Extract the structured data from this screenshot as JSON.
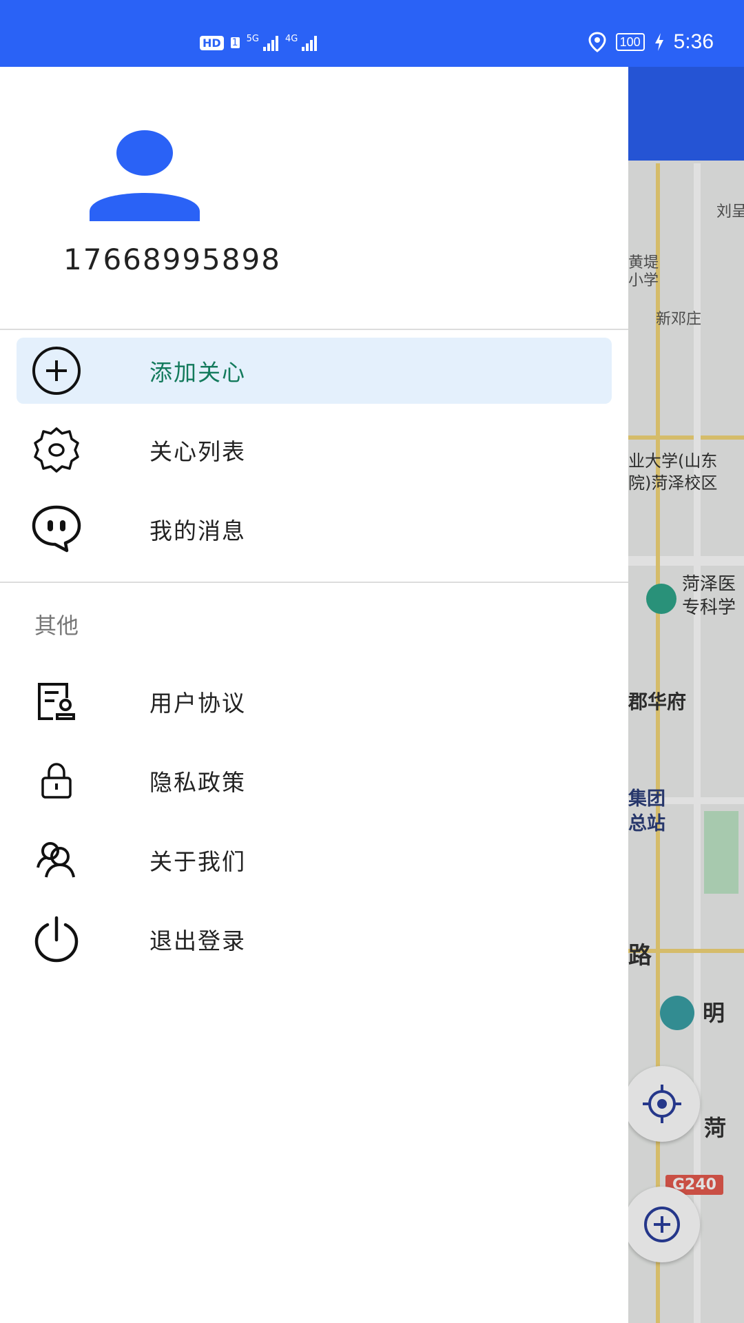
{
  "status_bar": {
    "hd": "HD",
    "sim": "1",
    "net1": "5G",
    "net2": "4G",
    "battery": "100",
    "time": "5:36"
  },
  "profile": {
    "phone": "17668995898"
  },
  "menu": {
    "items": [
      {
        "label": "添加关心",
        "icon": "add-circle-icon"
      },
      {
        "label": "关心列表",
        "icon": "gear-icon"
      },
      {
        "label": "我的消息",
        "icon": "chat-bubble-icon"
      }
    ]
  },
  "other": {
    "section_title": "其他",
    "items": [
      {
        "label": "用户协议",
        "icon": "agreement-document-icon"
      },
      {
        "label": "隐私政策",
        "icon": "lock-icon"
      },
      {
        "label": "关于我们",
        "icon": "people-icon"
      },
      {
        "label": "退出登录",
        "icon": "power-icon"
      }
    ]
  },
  "map": {
    "labels": [
      "刘呈",
      "黄堤",
      "小学",
      "新邓庄",
      "业大学(山东",
      "院)菏泽校区",
      "菏泽医",
      "专科学",
      "郡华府",
      "集团",
      "总站",
      "路",
      "明",
      "菏",
      "G240"
    ]
  },
  "colors": {
    "accent": "#2a62f6",
    "selected_bg": "#e4f0fc",
    "selected_text": "#137a5c"
  }
}
